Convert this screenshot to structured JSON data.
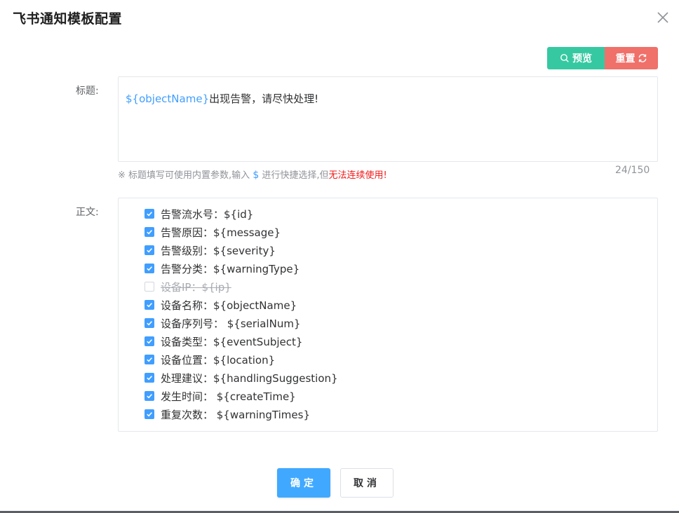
{
  "dialog": {
    "title": "飞书通知模板配置"
  },
  "toolbar": {
    "preview_label": "预览",
    "reset_label": "重置",
    "preview_icon": "search-icon",
    "reset_icon": "refresh-icon",
    "preview_color": "#36c9a1",
    "reset_color": "#f0706a"
  },
  "form": {
    "title_label": "标题:",
    "title_variable": "${objectName}",
    "title_text": "出现告警，请尽快处理!",
    "hint_prefix": "※ 标题填写可使用内置参数,输入",
    "hint_dollar": "$",
    "hint_middle": "进行快捷选择,但",
    "hint_warning": "无法连续使用!",
    "counter": "24/150",
    "body_label": "正文:"
  },
  "body_items": [
    {
      "label": "告警流水号：${id}",
      "checked": true
    },
    {
      "label": "告警原因：${message}",
      "checked": true
    },
    {
      "label": "告警级别：${severity}",
      "checked": true
    },
    {
      "label": "告警分类：${warningType}",
      "checked": true
    },
    {
      "label": "设备IP：${ip}",
      "checked": false
    },
    {
      "label": "设备名称：${objectName}",
      "checked": true
    },
    {
      "label": "设备序列号： ${serialNum}",
      "checked": true
    },
    {
      "label": "设备类型：${eventSubject}",
      "checked": true
    },
    {
      "label": "设备位置：${location}",
      "checked": true
    },
    {
      "label": "处理建议：${handlingSuggestion}",
      "checked": true
    },
    {
      "label": "发生时间： ${createTime}",
      "checked": true
    },
    {
      "label": "重复次数： ${warningTimes}",
      "checked": true
    }
  ],
  "footer": {
    "confirm_label": "确定",
    "cancel_label": "取消"
  },
  "colors": {
    "accent": "#409eff",
    "warning_text": "#f01818"
  }
}
